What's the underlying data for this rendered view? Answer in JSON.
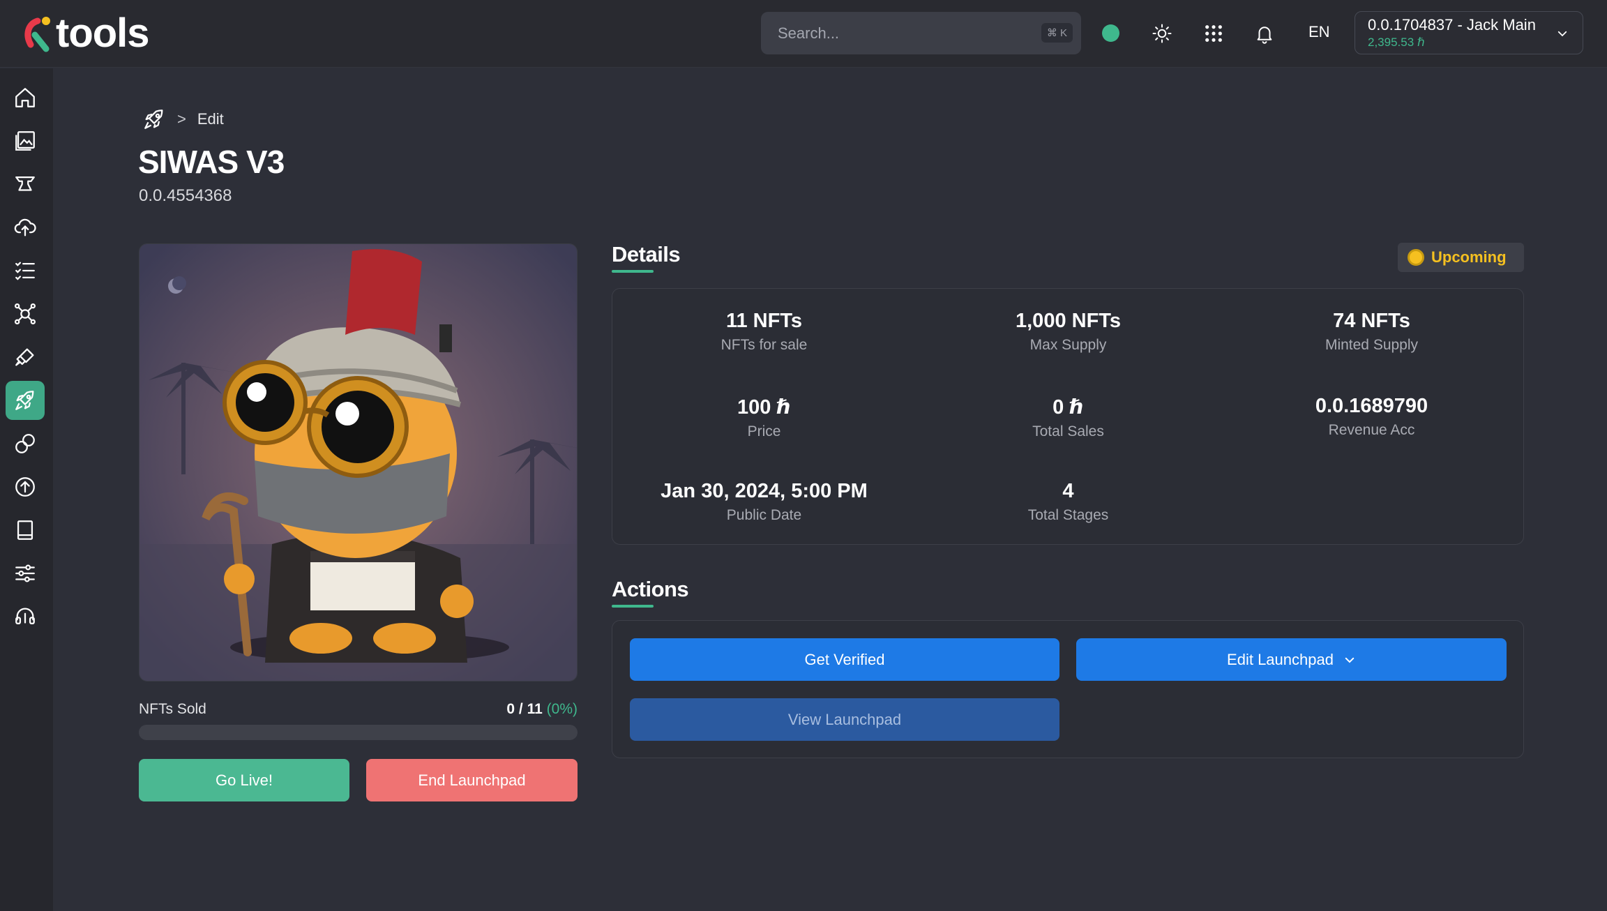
{
  "app": {
    "logo_text": "tools"
  },
  "search": {
    "placeholder": "Search...",
    "shortcut": "⌘ K"
  },
  "header": {
    "language": "EN",
    "account_name": "0.0.1704837 - Jack Main",
    "account_balance": "2,395.53 ℏ"
  },
  "colors": {
    "accent_green": "#3fb88d",
    "primary_blue": "#1e7ae6",
    "danger": "#ef7373",
    "warning": "#f5c020"
  },
  "sidebar": {
    "items": [
      {
        "icon": "home-icon"
      },
      {
        "icon": "gallery-icon"
      },
      {
        "icon": "anvil-icon"
      },
      {
        "icon": "cloud-upload-icon"
      },
      {
        "icon": "checklist-icon"
      },
      {
        "icon": "network-icon"
      },
      {
        "icon": "brush-icon"
      },
      {
        "icon": "rocket-icon",
        "active": true
      },
      {
        "icon": "link-icon"
      },
      {
        "icon": "arrow-up-circle-icon"
      },
      {
        "icon": "book-icon"
      },
      {
        "icon": "sliders-icon"
      },
      {
        "icon": "headset-icon"
      }
    ]
  },
  "breadcrumb": {
    "separator": ">",
    "current": "Edit"
  },
  "page": {
    "title": "SIWAS V3",
    "token_id": "0.0.4554368"
  },
  "sales": {
    "label": "NFTs Sold",
    "value": "0 / 11",
    "percent_text": "(0%)",
    "progress": 0
  },
  "buttons": {
    "go_live": "Go Live!",
    "end_launchpad": "End Launchpad"
  },
  "details": {
    "title": "Details",
    "status": "Upcoming",
    "stats": [
      {
        "value": "11 NFTs",
        "label": "NFTs for sale"
      },
      {
        "value": "1,000 NFTs",
        "label": "Max Supply"
      },
      {
        "value": "74 NFTs",
        "label": "Minted Supply"
      },
      {
        "value": "100 ℏ",
        "label": "Price"
      },
      {
        "value": "0 ℏ",
        "label": "Total Sales"
      },
      {
        "value": "0.0.1689790",
        "label": "Revenue Acc"
      },
      {
        "value": "Jan 30, 2024, 5:00 PM",
        "label": "Public Date"
      },
      {
        "value": "4",
        "label": "Total Stages"
      }
    ]
  },
  "actions": {
    "title": "Actions",
    "get_verified": "Get Verified",
    "edit_launchpad": "Edit Launchpad",
    "view_launchpad": "View Launchpad"
  }
}
